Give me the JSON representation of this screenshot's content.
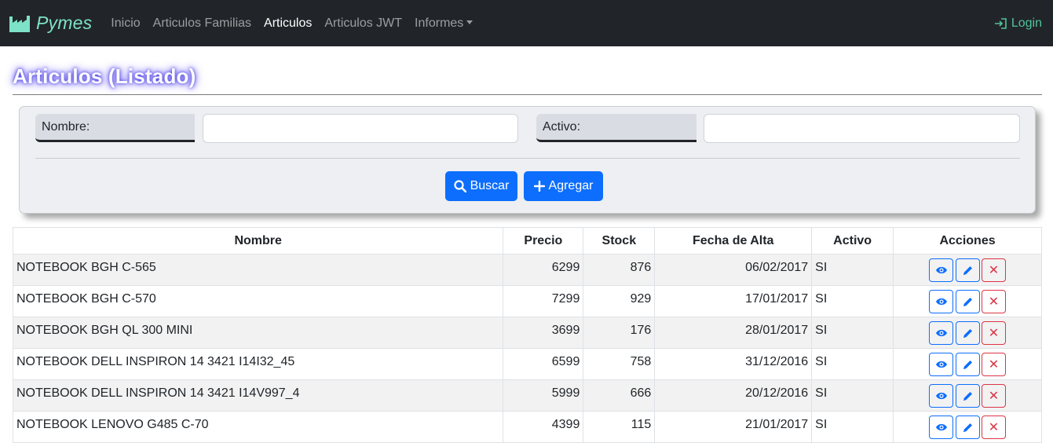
{
  "navbar": {
    "brand": "Pymes",
    "links": [
      {
        "label": "Inicio",
        "active": false
      },
      {
        "label": "Articulos Familias",
        "active": false
      },
      {
        "label": "Articulos",
        "active": true
      },
      {
        "label": "Articulos JWT",
        "active": false
      },
      {
        "label": "Informes",
        "active": false,
        "dropdown": true
      }
    ],
    "login_label": "Login",
    "brand_icon": "factory-icon",
    "login_icon": "sign-in-icon",
    "colors": {
      "background": "#212529",
      "brand": "#7ee2c8",
      "login": "#51c49a"
    }
  },
  "page": {
    "title": "Articulos (Listado)"
  },
  "filter": {
    "nombre_label": "Nombre:",
    "nombre_value": "",
    "activo_label": "Activo:",
    "activo_value": "",
    "buscar_label": "Buscar",
    "agregar_label": "Agregar",
    "buscar_icon": "search-icon",
    "agregar_icon": "plus-icon"
  },
  "table": {
    "headers": [
      "Nombre",
      "Precio",
      "Stock",
      "Fecha de Alta",
      "Activo",
      "Acciones"
    ],
    "rows": [
      {
        "nombre": "NOTEBOOK BGH C-565",
        "precio": "6299",
        "stock": "876",
        "fecha": "06/02/2017",
        "activo": "SI"
      },
      {
        "nombre": "NOTEBOOK BGH C-570",
        "precio": "7299",
        "stock": "929",
        "fecha": "17/01/2017",
        "activo": "SI"
      },
      {
        "nombre": "NOTEBOOK BGH QL 300 MINI",
        "precio": "3699",
        "stock": "176",
        "fecha": "28/01/2017",
        "activo": "SI"
      },
      {
        "nombre": "NOTEBOOK DELL INSPIRON 14 3421 I14I32_45",
        "precio": "6599",
        "stock": "758",
        "fecha": "31/12/2016",
        "activo": "SI"
      },
      {
        "nombre": "NOTEBOOK DELL INSPIRON 14 3421 I14V997_4",
        "precio": "5999",
        "stock": "666",
        "fecha": "20/12/2016",
        "activo": "SI"
      },
      {
        "nombre": "NOTEBOOK LENOVO G485 C-70",
        "precio": "4399",
        "stock": "115",
        "fecha": "21/01/2017",
        "activo": "SI"
      }
    ],
    "action_icons": [
      "eye-icon",
      "pencil-icon",
      "close-icon"
    ],
    "action_delete_glyph": "✕"
  }
}
